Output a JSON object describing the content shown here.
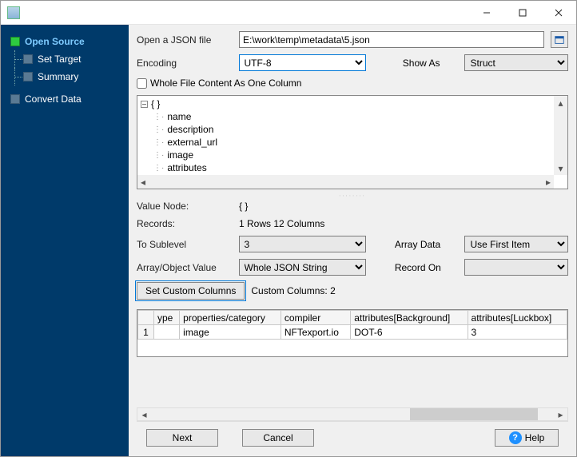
{
  "titlebar": {
    "title": ""
  },
  "sidebar": {
    "items": [
      {
        "label": "Open Source",
        "active": true
      },
      {
        "label": "Set Target"
      },
      {
        "label": "Summary"
      },
      {
        "label": "Convert Data"
      }
    ]
  },
  "form": {
    "open_label": "Open a JSON file",
    "file_path": "E:\\work\\temp\\metadata\\5.json",
    "encoding_label": "Encoding",
    "encoding_value": "UTF-8",
    "showas_label": "Show As",
    "showas_value": "Struct",
    "whole_file_label": "Whole File Content As One Column",
    "whole_file_checked": false
  },
  "tree": {
    "root": "{ }",
    "children": [
      "name",
      "description",
      "external_url",
      "image",
      "attributes"
    ]
  },
  "info": {
    "valuenode_label": "Value Node:",
    "valuenode_value": "{ }",
    "records_label": "Records:",
    "records_value": "1 Rows    12 Columns",
    "tosub_label": "To Sublevel",
    "tosub_value": "3",
    "arraydata_label": "Array Data",
    "arraydata_value": "Use First Item",
    "aovalue_label": "Array/Object Value",
    "aovalue_value": "Whole JSON String",
    "recordon_label": "Record On",
    "recordon_value": "",
    "setcustom_label": "Set Custom Columns",
    "customcols_label": "Custom Columns: 2"
  },
  "grid": {
    "headers": [
      "ype",
      "properties/category",
      "compiler",
      "attributes[Background]",
      "attributes[Luckbox]"
    ],
    "rows": [
      {
        "n": "1",
        "cells": [
          "",
          "image",
          "NFTexport.io",
          "DOT-6",
          "3"
        ]
      }
    ]
  },
  "footer": {
    "next": "Next",
    "cancel": "Cancel",
    "help": "Help"
  }
}
